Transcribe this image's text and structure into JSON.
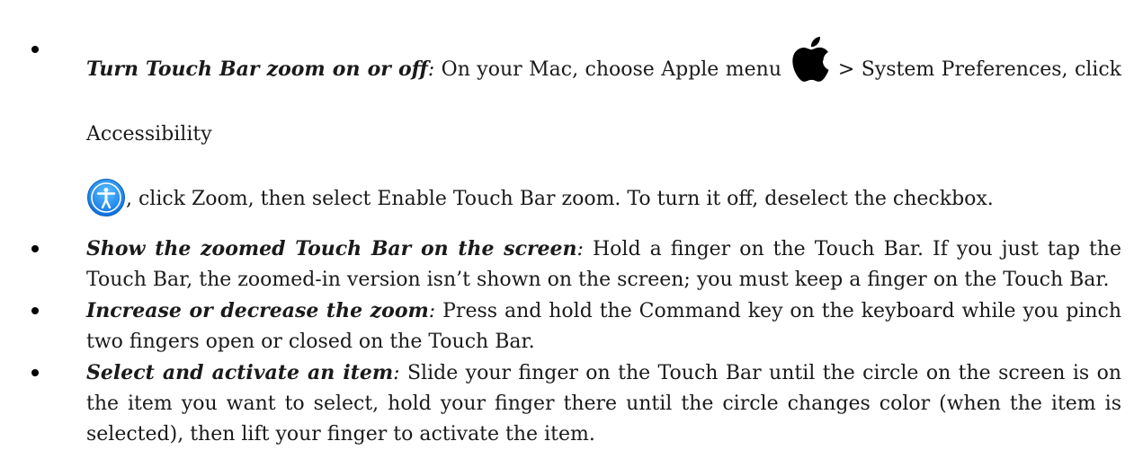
{
  "items": [
    {
      "lead": "Turn Touch Bar zoom on or off",
      "colon": ":",
      "part1": " On your Mac, choose Apple menu ",
      "apple_icon": "apple-logo-icon",
      "part2": " > System Preferences, click Accessibility ",
      "access_icon": "accessibility-icon",
      "part3": ", click Zoom, then select Enable Touch Bar zoom. To turn it off, deselect the checkbox."
    },
    {
      "lead": "Show the zoomed Touch Bar on the screen",
      "colon": ":",
      "text": " Hold a finger on the Touch Bar. If you just tap the Touch Bar, the zoomed-in version isn’t shown on the screen; you must keep a finger on the Touch Bar."
    },
    {
      "lead": "Increase or decrease the zoom",
      "colon": ":",
      "text": " Press and hold the Command key on the keyboard while you pinch two fingers open or closed on the Touch Bar."
    },
    {
      "lead": "Select and activate an item",
      "colon": ":",
      "text": " Slide your finger on the Touch Bar until the circle on the screen is on the item you want to select, hold your finger there until the circle changes color (when the item is selected), then lift your finger to activate the item."
    }
  ],
  "colors": {
    "accessibility_blue": "#1a8cff",
    "text": "#1a1a1a"
  }
}
